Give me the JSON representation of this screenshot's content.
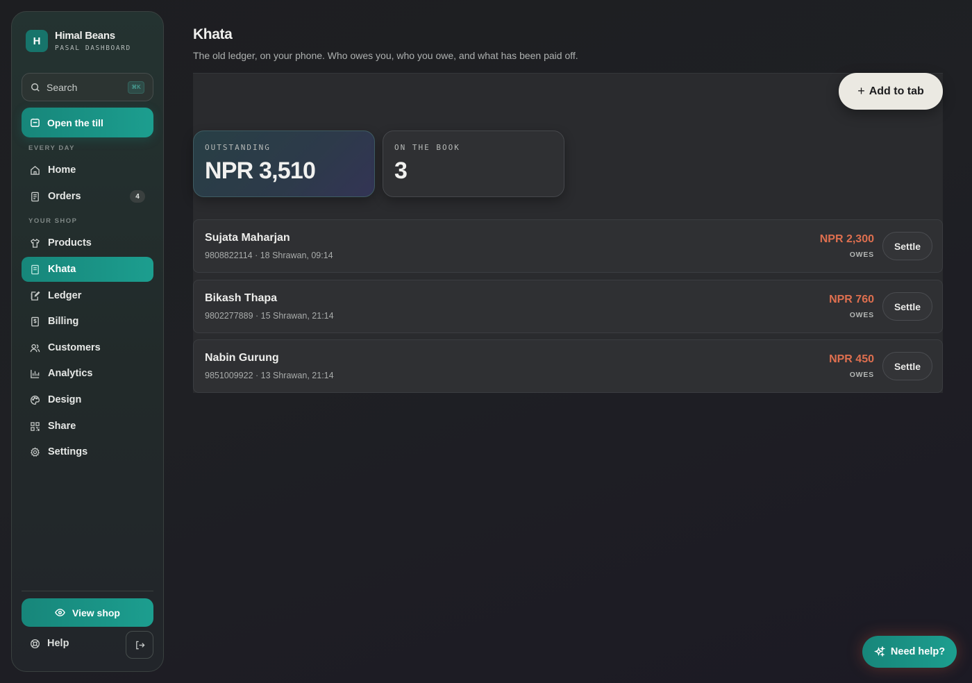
{
  "brand": {
    "initial": "H",
    "name": "Himal Beans",
    "subtitle": "PASAL DASHBOARD"
  },
  "search": {
    "placeholder": "Search",
    "shortcut": "⌘K"
  },
  "primary_action": {
    "label": "Open the till"
  },
  "sections": {
    "every_day": "EVERY DAY",
    "your_shop": "YOUR SHOP"
  },
  "nav": {
    "home": "Home",
    "orders": "Orders",
    "orders_badge": "4",
    "products": "Products",
    "khata": "Khata",
    "ledger": "Ledger",
    "billing": "Billing",
    "customers": "Customers",
    "analytics": "Analytics",
    "design": "Design",
    "share": "Share",
    "settings": "Settings"
  },
  "footer": {
    "view_shop": "View shop",
    "help": "Help"
  },
  "page": {
    "title": "Khata",
    "subtitle": "The old ledger, on your phone. Who owes you, who you owe, and what has been paid off."
  },
  "add_button": {
    "plus": "+",
    "label": "Add to tab"
  },
  "stats": {
    "outstanding": {
      "label": "OUTSTANDING",
      "value": "NPR 3,510"
    },
    "book": {
      "label": "ON THE BOOK",
      "value": "3"
    }
  },
  "entries": [
    {
      "name": "Sujata Maharjan",
      "meta": "9808822114 · 18 Shrawan, 09:14",
      "amount": "NPR 2,300",
      "status": "OWES",
      "action": "Settle"
    },
    {
      "name": "Bikash Thapa",
      "meta": "9802277889 · 15 Shrawan, 21:14",
      "amount": "NPR 760",
      "status": "OWES",
      "action": "Settle"
    },
    {
      "name": "Nabin Gurung",
      "meta": "9851009922 · 13 Shrawan, 21:14",
      "amount": "NPR 450",
      "status": "OWES",
      "action": "Settle"
    }
  ],
  "help_fab": {
    "label": "Need help?"
  },
  "colors": {
    "accent": "#1c9e8f",
    "owes": "#de6f4f",
    "background": "#1e1f22"
  }
}
